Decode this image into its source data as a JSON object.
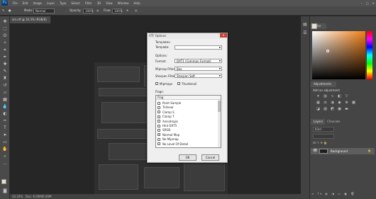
{
  "app": {
    "logo": "Ps"
  },
  "menu": {
    "items": [
      "File",
      "Edit",
      "Image",
      "Layer",
      "Type",
      "Select",
      "Filter",
      "3D",
      "View",
      "Window",
      "Help"
    ]
  },
  "window_controls": {
    "minimize": "–",
    "maximize": "□",
    "close": "✕"
  },
  "options_bar": {
    "mode_label": "Mode:",
    "mode_value": "Normal",
    "opacity_label": "Opacity:",
    "opacity_value": "100%",
    "flow_label": "Flow:",
    "flow_value": "100%"
  },
  "document": {
    "tab_title": "sm.vtf @ 33.3% (RGB/8)"
  },
  "status_bar": {
    "zoom": "33.33%",
    "doc_info": "Doc: 6.00M/6.00M"
  },
  "panels": {
    "color_tab": "Color",
    "adjustments_tab": "Adjustments",
    "adjustments_hint": "Add an adjustment",
    "layers_tab": "Layers",
    "channels_tab": "Channels",
    "layer_kind": "Kind",
    "layer_name": "Background"
  },
  "dialog": {
    "title": "VTF Options",
    "close": "✕",
    "templates_label": "Templates:",
    "template_label": "Template:",
    "template_value": "",
    "options_label": "Options:",
    "format_label": "Format:",
    "format_value": "DXT1 (Common Format)",
    "mipmap_filter_label": "Mipmap Filter:",
    "mipmap_filter_value": "Box",
    "sharpen_filter_label": "Sharpen Filter:",
    "sharpen_filter_value": "Sharpen Soft",
    "mipmaps_label": "Mipmaps",
    "mipmaps_checked": true,
    "thumbnail_label": "Thumbnail",
    "thumbnail_checked": true,
    "flags_label": "Flags:",
    "flags_header": "Flag",
    "flags": [
      {
        "label": "Point Sample",
        "checked": false
      },
      {
        "label": "Trilinear",
        "checked": false
      },
      {
        "label": "Clamp S",
        "checked": false
      },
      {
        "label": "Clamp T",
        "checked": false
      },
      {
        "label": "Anisotropic",
        "checked": false
      },
      {
        "label": "Hint DXT5",
        "checked": false
      },
      {
        "label": "SRGB",
        "checked": false
      },
      {
        "label": "Normal Map",
        "checked": true
      },
      {
        "label": "No Mipmap",
        "checked": false
      },
      {
        "label": "No Level Of Detail",
        "checked": false
      }
    ],
    "ok_label": "OK",
    "cancel_label": "Cancel"
  }
}
